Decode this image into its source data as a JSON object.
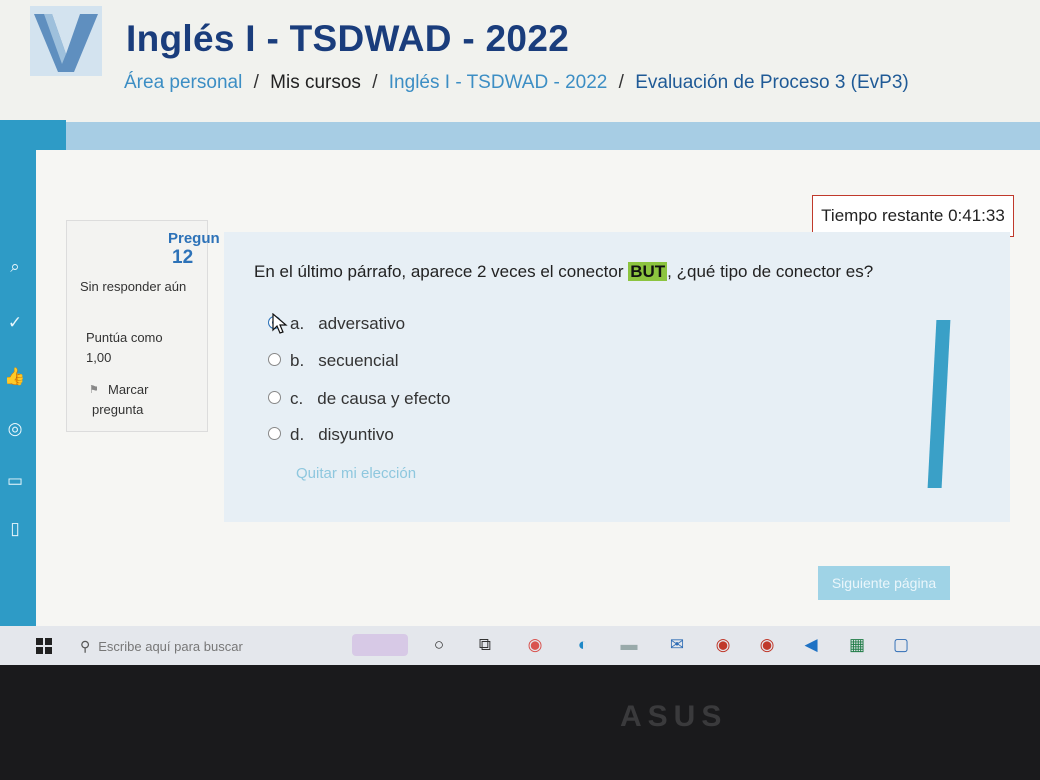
{
  "header": {
    "course_title": "Inglés I - TSDWAD - 2022",
    "breadcrumb": [
      {
        "label": "Área personal"
      },
      {
        "label": "Mis cursos"
      },
      {
        "label": "Inglés I - TSDWAD - 2022"
      },
      {
        "label": "Evaluación de Proceso 3 (EvP3)"
      }
    ],
    "separator": "/"
  },
  "timer": {
    "text": "Tiempo restante 0:41:33"
  },
  "question_info": {
    "label": "Pregun",
    "number": "12",
    "status": "Sin responder aún",
    "score_label": "Puntúa como",
    "score_value": "1,00",
    "flag_label": "Marcar pregunta"
  },
  "question": {
    "text_before": "En el último párrafo, aparece 2 veces el conector ",
    "highlight": "BUT",
    "text_after": ", ¿qué tipo de conector es?",
    "options": [
      {
        "letter": "a.",
        "text": "adversativo",
        "selected": true
      },
      {
        "letter": "b.",
        "text": "secuencial",
        "selected": false
      },
      {
        "letter": "c.",
        "text": "de causa y efecto",
        "selected": false
      },
      {
        "letter": "d.",
        "text": "disyuntivo",
        "selected": false
      }
    ],
    "clear_choice": "Quitar mi elección"
  },
  "navigation": {
    "next_label": "Siguiente página"
  },
  "taskbar": {
    "search_placeholder": "Escribe aquí para buscar"
  },
  "bezel": {
    "brand": "ASUS"
  },
  "colors": {
    "title": "#1a3d7c",
    "link": "#3c8ec4",
    "accent": "#2e9bc6",
    "highlight": "#8cc43f",
    "timer_border": "#c0392b"
  }
}
